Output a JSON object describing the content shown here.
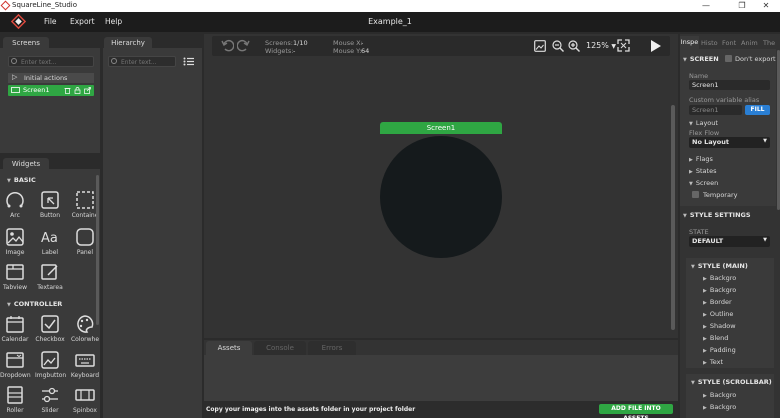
{
  "window": {
    "title": "SquareLine_Studio",
    "minimize": "—",
    "maximize": "❐",
    "close": "✕"
  },
  "menu": {
    "items": [
      "File",
      "Export",
      "Help"
    ],
    "project_title": "Example_1"
  },
  "screens_panel": {
    "tab": "Screens",
    "search_placeholder": "Enter text...",
    "initial_actions": "Initial actions",
    "screen_item": "Screen1"
  },
  "hierarchy_panel": {
    "tab": "Hierarchy",
    "search_placeholder": "Enter text..."
  },
  "widgets_panel": {
    "tab": "Widgets",
    "basic_header": "BASIC",
    "basic": [
      "Arc",
      "Button",
      "Containe",
      "Image",
      "Label",
      "Panel",
      "Tabview",
      "Textarea"
    ],
    "controller_header": "CONTROLLER",
    "controller": [
      "Calendar",
      "Checkbox",
      "Colorwhe",
      "Dropdown",
      "Imgbutton",
      "Keyboard",
      "Roller",
      "Slider",
      "Spinbox"
    ]
  },
  "canvas_toolbar": {
    "screens_label": "Screens:",
    "screens_value": "1/10",
    "widgets_label": "Widgets:",
    "widgets_value": "-",
    "mouse_x_label": "Mouse X:",
    "mouse_x_value": "-",
    "mouse_y_label": "Mouse Y:",
    "mouse_y_value": "64",
    "zoom": "125%"
  },
  "canvas": {
    "screen_name": "Screen1"
  },
  "bottom_panel": {
    "tabs": [
      "Assets",
      "Console",
      "Errors"
    ],
    "hint": "Copy your images into the assets folder in your project folder",
    "add_button": "ADD FILE INTO ASSETS"
  },
  "inspector": {
    "tabs": [
      "Inspe",
      "Histo",
      "Font",
      "Anim",
      "The"
    ],
    "screen_header": "SCREEN",
    "dont_export": "Don't export",
    "name_label": "Name",
    "name_value": "Screen1",
    "alias_label": "Custom variable alias",
    "alias_value": "Screen1",
    "fill_button": "FILL",
    "layout_label": "Layout",
    "flex_flow_label": "Flex Flow",
    "layout_value": "No Layout",
    "flags": "Flags",
    "states": "States",
    "screen_sub": "Screen",
    "temporary": "Temporary",
    "style_header": "STYLE SETTINGS",
    "state_label": "STATE",
    "state_value": "DEFAULT",
    "style_main": "STYLE (MAIN)",
    "main_props": [
      "Backgro",
      "Backgro",
      "Border",
      "Outline",
      "Shadow",
      "Blend",
      "Padding",
      "Text"
    ],
    "style_scrollbar": "STYLE (SCROLLBAR)",
    "scroll_props": [
      "Backgro",
      "Backgro"
    ]
  },
  "colors": {
    "accent_green": "#2fa643",
    "accent_blue": "#2a7fd4",
    "screen_fill": "#151a1c"
  }
}
